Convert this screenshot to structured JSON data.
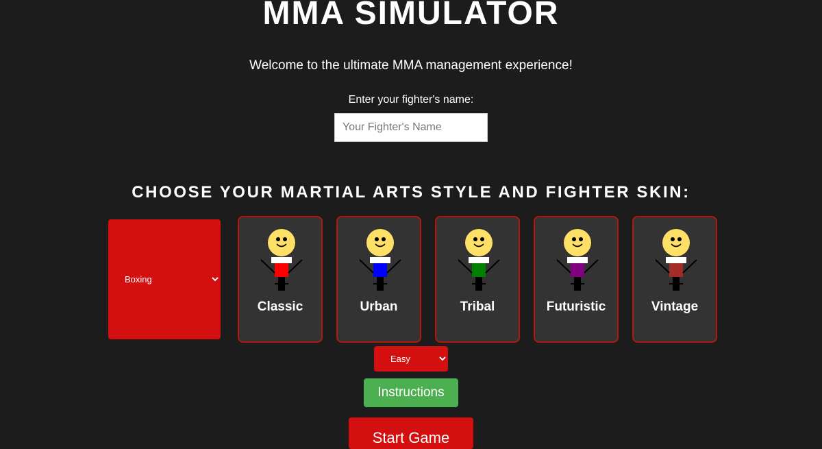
{
  "header": {
    "title": "MMA SIMULATOR",
    "welcome": "Welcome to the ultimate MMA management experience!"
  },
  "name_entry": {
    "label": "Enter your fighter's name:",
    "placeholder": "Your Fighter's Name",
    "value": ""
  },
  "selection": {
    "heading": "CHOOSE YOUR MARTIAL ARTS STYLE AND FIGHTER SKIN:",
    "style_selected": "Boxing",
    "skins": [
      {
        "label": "Classic",
        "color": "#ff0000",
        "icon": "stick-fighter-icon"
      },
      {
        "label": "Urban",
        "color": "#0000ff",
        "icon": "stick-fighter-icon"
      },
      {
        "label": "Tribal",
        "color": "#008000",
        "icon": "stick-fighter-icon"
      },
      {
        "label": "Futuristic",
        "color": "#800080",
        "icon": "stick-fighter-icon"
      },
      {
        "label": "Vintage",
        "color": "#a52a2a",
        "icon": "stick-fighter-icon"
      }
    ]
  },
  "difficulty": {
    "selected": "Easy"
  },
  "buttons": {
    "instructions": "Instructions",
    "start": "Start Game"
  },
  "colors": {
    "background": "#1c1c1c",
    "accent_red": "#d40f0f",
    "card_border": "#b5170f",
    "card_bg": "#333333",
    "instructions_green": "#4caf50",
    "face_yellow": "#ffe066"
  }
}
